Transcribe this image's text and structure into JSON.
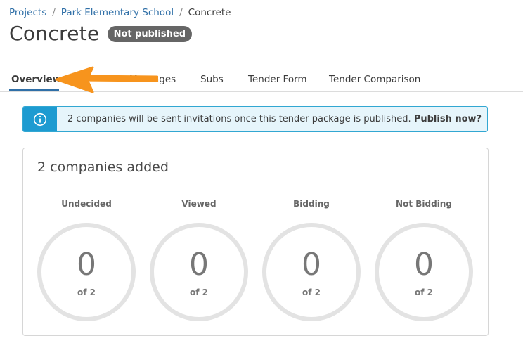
{
  "breadcrumb": {
    "items": [
      "Projects",
      "Park Elementary School"
    ],
    "separator": "/",
    "current": "Concrete"
  },
  "page": {
    "title": "Concrete",
    "status_badge": "Not published"
  },
  "tabs": [
    {
      "label": "Overview",
      "active": true
    },
    {
      "label": "Messages",
      "active": false
    },
    {
      "label": "Subs",
      "active": false
    },
    {
      "label": "Tender Form",
      "active": false
    },
    {
      "label": "Tender Comparison",
      "active": false
    }
  ],
  "banner": {
    "icon": "info-icon",
    "message": "2 companies will be sent invitations once this tender package is published.",
    "action": "Publish now?"
  },
  "summary": {
    "title": "2 companies added",
    "stats": [
      {
        "label": "Undecided",
        "value": "0",
        "total": "of 2"
      },
      {
        "label": "Viewed",
        "value": "0",
        "total": "of 2"
      },
      {
        "label": "Bidding",
        "value": "0",
        "total": "of 2"
      },
      {
        "label": "Not Bidding",
        "value": "0",
        "total": "of 2"
      }
    ]
  },
  "colors": {
    "link": "#2f6fa7",
    "badge": "#666666",
    "info": "#1d9bd1",
    "annotation_arrow": "#f7941d"
  }
}
